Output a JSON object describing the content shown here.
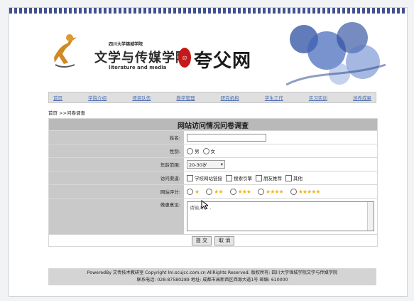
{
  "header": {
    "school_small": "四川大学锦城学院",
    "school_cn": "文学与传媒学院",
    "school_en": "literature and media",
    "brand": "夸父网"
  },
  "nav": [
    "首页",
    "学院介绍",
    "师资队伍",
    "教学管理",
    "研究机构",
    "学生工作",
    "实习实训",
    "培养成果"
  ],
  "breadcrumb": "首页 >>问卷调查",
  "survey": {
    "title": "网站访问情况问卷调查",
    "name_label": "姓名:",
    "gender_label": "性别:",
    "gender_options": [
      "男",
      "女"
    ],
    "age_label": "年龄范围:",
    "age_selected": "20-30岁",
    "channel_label": "访问渠道:",
    "channel_options": [
      "学校网站链接",
      "搜索引擎",
      "朋友推荐",
      "其他"
    ],
    "rating_label": "网站评分:",
    "rating_options": [
      1,
      2,
      3,
      4,
      5
    ],
    "comment_label": "做患意见:",
    "comment_placeholder": "请输入...",
    "submit_label": "提 交",
    "cancel_label": "取 消"
  },
  "footer": {
    "line1": "PoweredBy 文传技术教研室 Copyright lm.scujcc.com.cn AllRights Reserved. 版权所有: 四川大学锦城学院文学与传媒学院",
    "line2": "联系电话: 028-87580289 地址: 成都市高新西区西源大道1号 邮编: 610000"
  },
  "colors": {
    "nav_link": "#4c6fb3",
    "star": "#f1b515",
    "seal": "#c4191a",
    "label_bg": "#c9c9c9"
  }
}
